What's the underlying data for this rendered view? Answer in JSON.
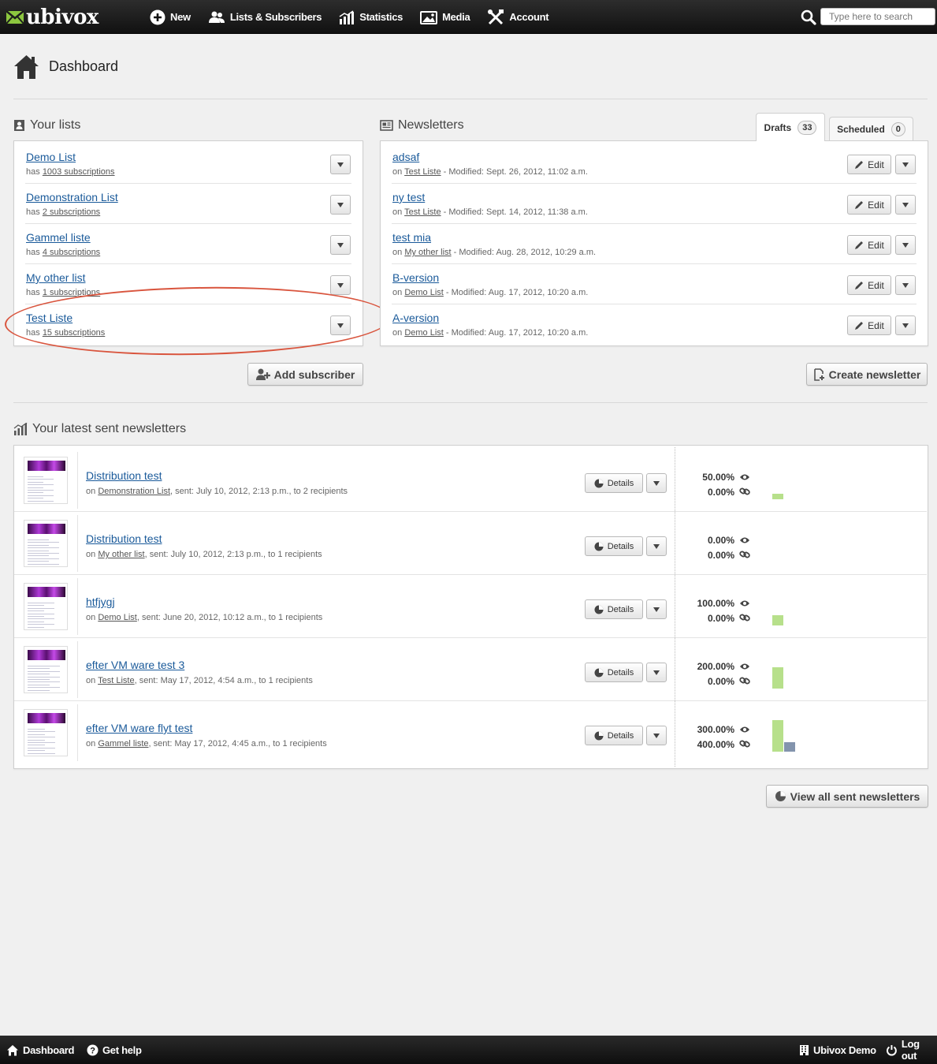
{
  "app": {
    "logo_text": "ubivox",
    "brand_color": "#8cc63f"
  },
  "nav": {
    "items": [
      {
        "label": "New",
        "icon": "plus-circle-icon"
      },
      {
        "label": "Lists & Subscribers",
        "icon": "users-icon"
      },
      {
        "label": "Statistics",
        "icon": "chart-icon"
      },
      {
        "label": "Media",
        "icon": "image-icon"
      },
      {
        "label": "Account",
        "icon": "tools-icon"
      }
    ],
    "search_placeholder": "Type here to search"
  },
  "page": {
    "title": "Dashboard"
  },
  "lists": {
    "section_title": "Your lists",
    "items": [
      {
        "name": "Demo List",
        "has": "has",
        "subs": "1003 subscriptions"
      },
      {
        "name": "Demonstration List",
        "has": "has",
        "subs": "2 subscriptions"
      },
      {
        "name": "Gammel liste",
        "has": "has",
        "subs": "4 subscriptions"
      },
      {
        "name": "My other list",
        "has": "has",
        "subs": "1 subscriptions"
      },
      {
        "name": "Test Liste",
        "has": "has",
        "subs": "15 subscriptions"
      }
    ],
    "add_button": "Add subscriber"
  },
  "newsletters": {
    "section_title": "Newsletters",
    "tabs": [
      {
        "label": "Drafts",
        "count": "33"
      },
      {
        "label": "Scheduled",
        "count": "0"
      }
    ],
    "items": [
      {
        "name": "adsaf",
        "on": "on",
        "list": "Test Liste",
        "modified": " - Modified: Sept. 26, 2012, 11:02 a.m."
      },
      {
        "name": "ny test",
        "on": "on",
        "list": "Test Liste",
        "modified": " - Modified: Sept. 14, 2012, 11:38 a.m."
      },
      {
        "name": "test mia",
        "on": "on",
        "list": "My other list",
        "modified": " - Modified: Aug. 28, 2012, 10:29 a.m."
      },
      {
        "name": "B-version",
        "on": "on",
        "list": "Demo List",
        "modified": " - Modified: Aug. 17, 2012, 10:20 a.m."
      },
      {
        "name": "A-version",
        "on": "on",
        "list": "Demo List",
        "modified": " - Modified: Aug. 17, 2012, 10:20 a.m."
      }
    ],
    "edit_label": "Edit",
    "create_button": "Create newsletter"
  },
  "sent": {
    "section_title": "Your latest sent newsletters",
    "details_label": "Details",
    "items": [
      {
        "name": "Distribution test",
        "on": "on",
        "list": "Demonstration List",
        "info": ", sent: July 10, 2012, 2:13 p.m., to 2 recipients",
        "open": "50.00%",
        "click": "0.00%",
        "open_value": 50,
        "click_value": 0
      },
      {
        "name": "Distribution test",
        "on": "on",
        "list": "My other list",
        "info": ", sent: July 10, 2012, 2:13 p.m., to 1 recipients",
        "open": "0.00%",
        "click": "0.00%",
        "open_value": 0,
        "click_value": 0
      },
      {
        "name": "htfjygj",
        "on": "on",
        "list": "Demo List",
        "info": ", sent: June 20, 2012, 10:12 a.m., to 1 recipients",
        "open": "100.00%",
        "click": "0.00%",
        "open_value": 100,
        "click_value": 0
      },
      {
        "name": "efter VM ware test 3",
        "on": "on",
        "list": "Test Liste",
        "info": ", sent: May 17, 2012, 4:54 a.m., to 1 recipients",
        "open": "200.00%",
        "click": "0.00%",
        "open_value": 200,
        "click_value": 0
      },
      {
        "name": "efter VM ware flyt test",
        "on": "on",
        "list": "Gammel liste",
        "info": ", sent: May 17, 2012, 4:45 a.m., to 1 recipients",
        "open": "300.00%",
        "click": "400.00%",
        "open_value": 300,
        "click_value": 400
      }
    ],
    "view_all_button": "View all sent newsletters"
  },
  "footer": {
    "dashboard": "Dashboard",
    "help": "Get help",
    "account": "Ubivox Demo",
    "logout": "Log out"
  }
}
